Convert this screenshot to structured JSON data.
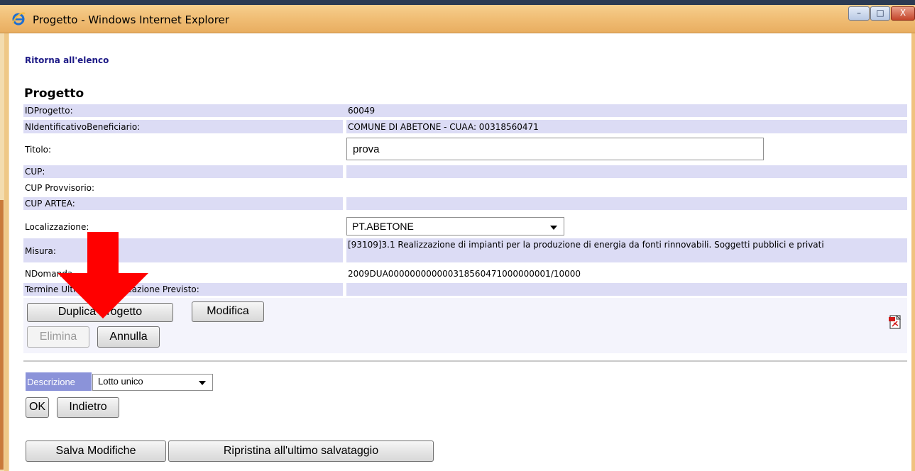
{
  "window": {
    "title": "Progetto - Windows Internet Explorer",
    "min_glyph": "–",
    "max_glyph": "□",
    "close_glyph": "X"
  },
  "nav": {
    "back_link": "Ritorna all'elenco"
  },
  "page": {
    "heading": "Progetto"
  },
  "fields": {
    "id_progetto": {
      "label": "IDProgetto:",
      "value": "60049"
    },
    "beneficiario": {
      "label": "NIdentificativoBeneficiario:",
      "value": "COMUNE DI ABETONE - CUAA: 00318560471"
    },
    "titolo": {
      "label": "Titolo:",
      "value": "prova"
    },
    "cup": {
      "label": "CUP:",
      "value": ""
    },
    "cup_provvisorio": {
      "label": "CUP Provvisorio:",
      "value": ""
    },
    "cup_artea": {
      "label": "CUP ARTEA:",
      "value": ""
    },
    "localizzazione": {
      "label": "Localizzazione:",
      "value": "PT.ABETONE"
    },
    "misura": {
      "label": "Misura:",
      "value": "[93109]3.1 Realizzazione di impianti per la produzione di energia da fonti rinnovabili. Soggetti pubblici e privati"
    },
    "ndomanda": {
      "label": "NDomanda",
      "value": "2009DUA000000000000318560471000000001/10000"
    },
    "termine": {
      "label": "Termine Ultimo di Realizzazione Previsto:",
      "value": ""
    }
  },
  "actions": {
    "duplica": "Duplica Progetto",
    "modifica": "Modifica",
    "elimina": "Elimina",
    "annulla": "Annulla"
  },
  "lotto": {
    "label": "Descrizione",
    "selected": "Lotto unico",
    "ok": "OK",
    "indietro": "Indietro"
  },
  "footer": {
    "salva": "Salva Modifiche",
    "ripristina": "Ripristina all'ultimo salvataggio"
  },
  "colors": {
    "row_shade": "#dcdcf5",
    "label_badge": "#8b93d9",
    "link": "#1d1a86",
    "annotation_arrow": "#ff0000"
  },
  "icons": [
    "ie-logo-icon",
    "pdf-icon",
    "red-arrow-annotation"
  ]
}
